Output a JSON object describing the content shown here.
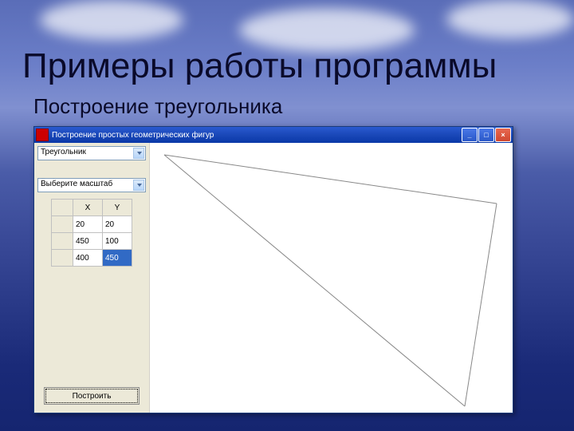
{
  "slide": {
    "title": "Примеры работы программы",
    "subtitle": "Построение треугольника"
  },
  "window": {
    "title": "Построение простых геометрических фигур",
    "buttons": {
      "min": "_",
      "max": "□",
      "close": "×"
    }
  },
  "sidebar": {
    "shape_combo": "Треугольник",
    "scale_combo": "Выберите масштаб",
    "table": {
      "headers": {
        "x": "X",
        "y": "Y"
      },
      "rows": [
        {
          "x": "20",
          "y": "20"
        },
        {
          "x": "450",
          "y": "100"
        },
        {
          "x": "400",
          "y": "450"
        }
      ]
    },
    "build_button": "Построить"
  },
  "chart_data": {
    "type": "scatter",
    "title": "",
    "xlabel": "X",
    "ylabel": "Y",
    "series": [
      {
        "name": "triangle",
        "x": [
          20,
          450,
          400
        ],
        "y": [
          20,
          100,
          450
        ]
      }
    ],
    "xlim": [
      0,
      460
    ],
    "ylim": [
      0,
      460
    ]
  }
}
